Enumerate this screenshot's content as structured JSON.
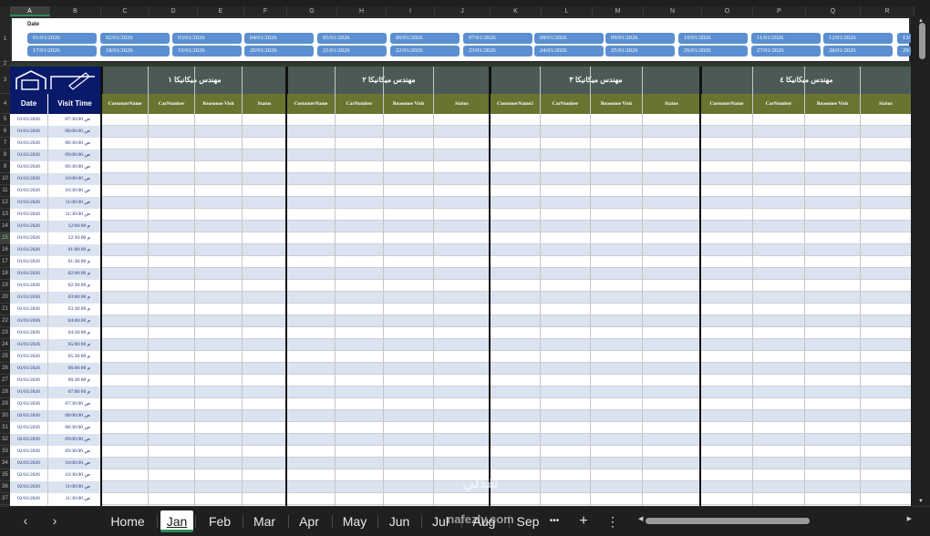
{
  "columns": [
    "A",
    "B",
    "C",
    "D",
    "E",
    "F",
    "G",
    "H",
    "I",
    "J",
    "K",
    "L",
    "M",
    "N",
    "O",
    "P",
    "Q",
    "R"
  ],
  "selected_column": "A",
  "row_numbers": [
    "1",
    "2",
    "3",
    "4",
    "5",
    "6",
    "7",
    "8",
    "9",
    "10",
    "11",
    "12",
    "13",
    "14",
    "15",
    "16",
    "17",
    "18",
    "19",
    "20",
    "21",
    "22",
    "23",
    "24",
    "25",
    "26",
    "27",
    "28",
    "29",
    "30",
    "31",
    "32",
    "33",
    "34",
    "35",
    "36",
    "37"
  ],
  "selected_row": "15",
  "date_panel": {
    "label": "Date",
    "row1": [
      "01/01/2026",
      "02/01/2026",
      "03/01/2026",
      "04/01/2026",
      "05/01/2026",
      "06/01/2026",
      "07/01/2026",
      "08/01/2026",
      "09/01/2026",
      "10/01/2026",
      "11/01/2026",
      "12/01/2026",
      "13/"
    ],
    "row2": [
      "17/01/2026",
      "18/01/2026",
      "19/01/2026",
      "20/01/2026",
      "21/01/2026",
      "22/01/2026",
      "23/01/2026",
      "24/01/2026",
      "25/01/2026",
      "26/01/2026",
      "27/01/2026",
      "28/01/2026",
      "29/"
    ]
  },
  "headers": {
    "date": "Date",
    "visit_time": "Visit Time",
    "engineers": [
      "مهندس ميكانيكا ١",
      "مهندس ميكانيكا ٢",
      "مهندس ميكانيكا ٣",
      "مهندس ميكانيكا ٤"
    ],
    "subheaders": [
      [
        "CustomerName",
        "CarNumber",
        "Reasonoe Visit",
        "Status"
      ],
      [
        "CustomerName",
        "CarNumber",
        "Reasonoe Visit",
        "Status"
      ],
      [
        "CustomerName2",
        "CarNumber",
        "Reasonoe Visit",
        "Status"
      ],
      [
        "CustomerName",
        "CarNumber",
        "Reasonoe Visit",
        "Status"
      ]
    ]
  },
  "rows": [
    {
      "date": "01/01/2026",
      "time": "07:30:00 ص"
    },
    {
      "date": "01/01/2026",
      "time": "08:00:00 ص"
    },
    {
      "date": "01/01/2026",
      "time": "08:30:00 ص"
    },
    {
      "date": "01/01/2026",
      "time": "09:00:00 ص"
    },
    {
      "date": "01/01/2026",
      "time": "09:30:00 ص"
    },
    {
      "date": "01/01/2026",
      "time": "10:00:00 ص"
    },
    {
      "date": "01/01/2026",
      "time": "10:30:00 ص"
    },
    {
      "date": "01/01/2026",
      "time": "11:00:00 ص"
    },
    {
      "date": "01/01/2026",
      "time": "11:30:00 ص"
    },
    {
      "date": "01/01/2026",
      "time": "12:00:00 م"
    },
    {
      "date": "01/01/2026",
      "time": "12:30:00 م"
    },
    {
      "date": "01/01/2026",
      "time": "01:00:00 م"
    },
    {
      "date": "01/01/2026",
      "time": "01:30:00 م"
    },
    {
      "date": "01/01/2026",
      "time": "02:00:00 م"
    },
    {
      "date": "01/01/2026",
      "time": "02:30:00 م"
    },
    {
      "date": "01/01/2026",
      "time": "03:00:00 م"
    },
    {
      "date": "01/01/2026",
      "time": "03:30:00 م"
    },
    {
      "date": "01/01/2026",
      "time": "04:00:00 م"
    },
    {
      "date": "01/01/2026",
      "time": "04:30:00 م"
    },
    {
      "date": "01/01/2026",
      "time": "05:00:00 م"
    },
    {
      "date": "01/01/2026",
      "time": "05:30:00 م"
    },
    {
      "date": "01/01/2026",
      "time": "06:00:00 م"
    },
    {
      "date": "01/01/2026",
      "time": "06:30:00 م"
    },
    {
      "date": "01/01/2026",
      "time": "07:00:00 م"
    },
    {
      "date": "02/01/2026",
      "time": "07:30:00 ص"
    },
    {
      "date": "02/01/2026",
      "time": "08:00:00 ص"
    },
    {
      "date": "02/01/2026",
      "time": "08:30:00 ص"
    },
    {
      "date": "02/01/2026",
      "time": "09:00:00 ص"
    },
    {
      "date": "02/01/2026",
      "time": "09:30:00 ص"
    },
    {
      "date": "02/01/2026",
      "time": "10:00:00 ص"
    },
    {
      "date": "02/01/2026",
      "time": "10:30:00 ص"
    },
    {
      "date": "02/01/2026",
      "time": "11:00:00 ص"
    },
    {
      "date": "02/01/2026",
      "time": "11:30:00 ص"
    }
  ],
  "tabs": [
    "Home",
    "Jan",
    "Feb",
    "Mar",
    "Apr",
    "May",
    "Jun",
    "Jul",
    "Aug",
    "Sep"
  ],
  "active_tab": "Jan",
  "more_tabs": "•••",
  "add_sheet": "+",
  "options": "⋮",
  "watermark": "نفذلي",
  "watermark_url": "nafezly.com"
}
